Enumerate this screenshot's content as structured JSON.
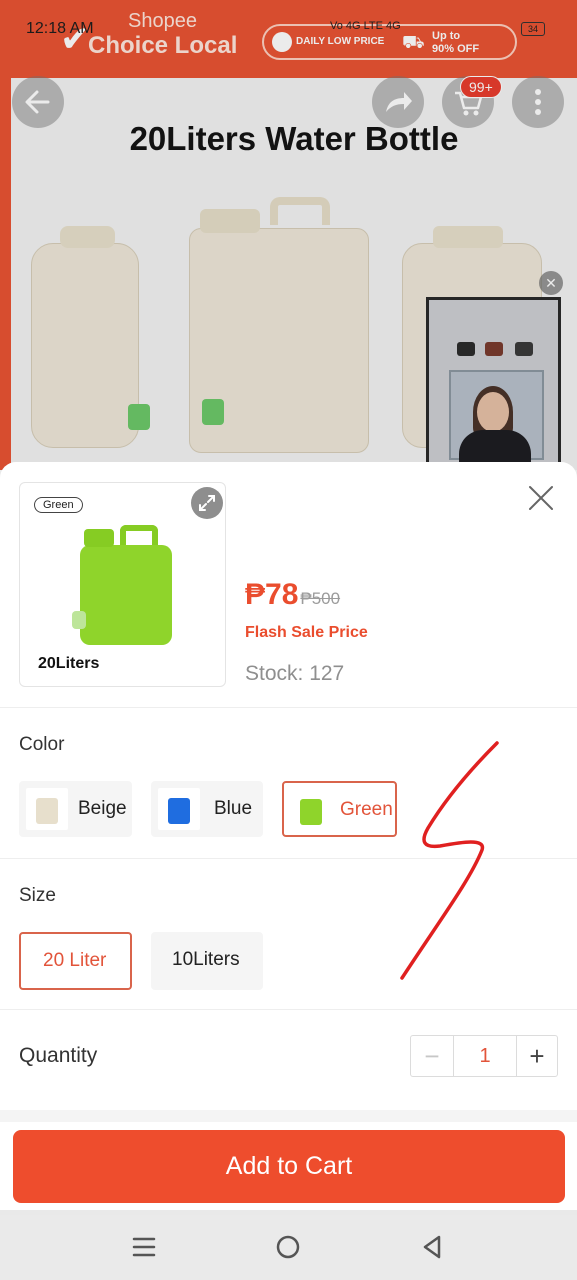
{
  "status_bar": {
    "time": "12:18 AM",
    "signal_text": "Vo 4G LTE 4G",
    "battery": "34"
  },
  "banner": {
    "brand_small": "Shopee",
    "brand_large": "Choice Local",
    "promo_left": "DAILY LOW PRICE",
    "promo_right_line1": "Up to",
    "promo_right_line2": "90% OFF"
  },
  "product_image": {
    "title": "20Liters Water Bottle",
    "cart_badge": "99+"
  },
  "icons": {
    "back": "back-arrow-icon",
    "share": "share-icon",
    "cart": "cart-icon",
    "more": "more-vertical-icon",
    "close": "close-icon",
    "expand": "expand-icon"
  },
  "sheet": {
    "thumb_tag": "Green",
    "thumb_label": "20Liters",
    "price": "₱78",
    "original_price": "₱500",
    "flash_label": "Flash Sale Price",
    "stock": "Stock: 127",
    "color_label": "Color",
    "colors": [
      {
        "label": "Beige",
        "swatch": "#e7dfcc",
        "selected": false
      },
      {
        "label": "Blue",
        "swatch": "#1f6de0",
        "selected": false
      },
      {
        "label": "Green",
        "swatch": "#8fd42b",
        "selected": true
      }
    ],
    "size_label": "Size",
    "sizes": [
      {
        "label": "20 Liter",
        "selected": true
      },
      {
        "label": "10Liters",
        "selected": false
      }
    ],
    "quantity_label": "Quantity",
    "quantity_minus": "−",
    "quantity_value": "1",
    "quantity_plus": "+",
    "cta": "Add to Cart"
  },
  "colors": {
    "brand": "#ee4d2d",
    "accent_text": "#ea4d2e",
    "selected_border": "#d9644b",
    "annotation": "#e02020"
  }
}
